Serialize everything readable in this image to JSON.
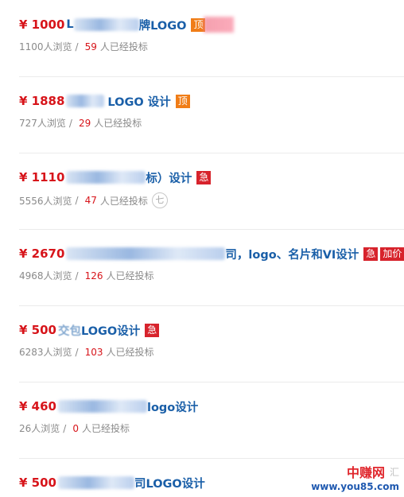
{
  "currency_symbol": "¥",
  "items": [
    {
      "price": "1000",
      "title_prefix": "L",
      "title_suffix": "牌LOGO",
      "badges": [
        {
          "type": "top",
          "label": "顶"
        }
      ],
      "views": "1100人浏览",
      "separator": "/",
      "bids": "59",
      "bids_suffix": "人已经投标"
    },
    {
      "price": "1888",
      "title_prefix": "",
      "title_suffix": "LOGO 设计",
      "badges": [
        {
          "type": "top",
          "label": "顶"
        }
      ],
      "views": "727人浏览",
      "separator": "/",
      "bids": "29",
      "bids_suffix": "人已经投标"
    },
    {
      "price": "1110",
      "title_prefix": "",
      "title_suffix": "标）设计",
      "badges": [
        {
          "type": "urgent",
          "label": "急"
        }
      ],
      "views": "5556人浏览",
      "separator": "/",
      "bids": "47",
      "bids_suffix": "人已经投标",
      "extra_icon": "七"
    },
    {
      "price": "2670",
      "title_prefix": "",
      "title_suffix": "司，logo、名片和VI设计",
      "badges": [
        {
          "type": "urgent",
          "label": "急"
        },
        {
          "type": "raise",
          "label": "加价"
        }
      ],
      "views": "4968人浏览",
      "separator": "/",
      "bids": "126",
      "bids_suffix": "人已经投标"
    },
    {
      "price": "500",
      "title_prefix": "交包",
      "title_suffix": "LOGO设计",
      "badges": [
        {
          "type": "urgent",
          "label": "急"
        }
      ],
      "views": "6283人浏览",
      "separator": "/",
      "bids": "103",
      "bids_suffix": "人已经投标"
    },
    {
      "price": "460",
      "title_prefix": "",
      "title_suffix": "logo设计",
      "badges": [],
      "views": "26人浏览",
      "separator": "/",
      "bids": "0",
      "bids_suffix": "人已经投标"
    },
    {
      "price": "500",
      "title_prefix": "",
      "title_suffix": "司LOGO设计",
      "badges": [],
      "views": "",
      "separator": "",
      "bids": "",
      "bids_suffix": ""
    }
  ],
  "watermark": {
    "title": "中赚网",
    "subtitle": "汇",
    "url": "www.you85.com"
  }
}
